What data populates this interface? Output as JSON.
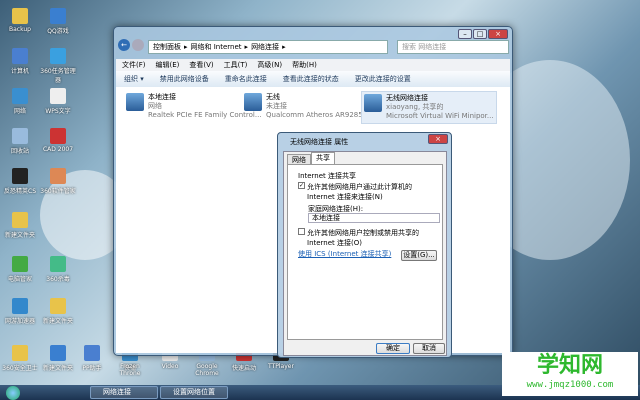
{
  "desktop_icons": [
    "Backup",
    "QQ游戏",
    "计算机",
    "360任务管理器",
    "网络",
    "WPS文字",
    "回收站",
    "CAD 2007",
    "反恐精英CS",
    "360软件管家",
    "新建文件夹",
    "电脑管家",
    "360杀毒",
    "网游加速器",
    "新建文件夹",
    "360安全卫士",
    "新建文件夹",
    "PP助手",
    "快播",
    "Frozen Throne",
    "Video",
    "Google Chrome",
    "快速启动",
    "TTPlayer"
  ],
  "window": {
    "breadcrumb": [
      "控制面板",
      "网络和 Internet",
      "网络连接"
    ],
    "search_placeholder": "搜索 网络连接",
    "menu": [
      "文件(F)",
      "编辑(E)",
      "查看(V)",
      "工具(T)",
      "高级(N)",
      "帮助(H)"
    ],
    "toolbar": [
      "组织 ▾",
      "禁用此网络设备",
      "重命名此连接",
      "查看此连接的状态",
      "更改此连接的设置"
    ],
    "connections": [
      {
        "name": "本地连接",
        "status": "网络",
        "device": "Realtek PCIe FE Family Control..."
      },
      {
        "name": "无线",
        "status": "未连接",
        "device": "Qualcomm Atheros AR9285 W..."
      },
      {
        "name": "无线网络连接",
        "status": "xiaoyang, 共享的",
        "device": "Microsoft Virtual WiFi Minipor..."
      }
    ]
  },
  "dialog": {
    "title": "无线网络连接 属性",
    "tabs": [
      "网络",
      "共享"
    ],
    "group": "Internet 连接共享",
    "allow_share": "允许其他网络用户通过此计算机的 Internet 连接来连接(N)",
    "home_label": "家庭网络连接(H):",
    "home_value": "本地连接",
    "allow_control": "允许其他网络用户控制或禁用共享的 Internet 连接(O)",
    "ics_link": "使用 ICS (Internet 连接共享)",
    "settings": "设置(G)...",
    "ok": "确定",
    "cancel": "取消"
  },
  "taskbar": [
    "网络连接",
    "设置网络位置"
  ],
  "watermark": {
    "title": "学知网",
    "url": "www.jmqz1000.com"
  }
}
